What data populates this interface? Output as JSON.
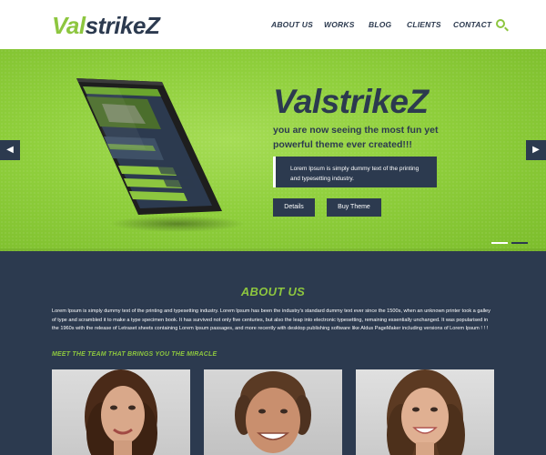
{
  "header": {
    "logo_part1": "Val",
    "logo_part2": "strikeZ",
    "nav": [
      "ABOUT US",
      "WORKS",
      "BLOG",
      "CLIENTS",
      "CONTACT"
    ],
    "search_icon": "search-icon"
  },
  "hero": {
    "title": "ValstrikeZ",
    "subtitle": "you are now seeing the most fun yet powerful theme ever created!!!",
    "quote": "Lorem Ipsum is simply dummy text of the printing and typesetting industry.",
    "details_label": "Details",
    "buy_label": "Buy Theme",
    "prev_icon": "chevron-left-icon",
    "next_icon": "chevron-right-icon",
    "slides": 2,
    "active_slide": 1
  },
  "about": {
    "title": "ABOUT US",
    "text": "Lorem Ipsum is simply dummy text of the printing and typesetting industry. Lorem Ipsum has been the industry's standard dummy text ever since the 1500s, when an unknown printer took a galley of type and scrambled it to make a type specimen book. It has survived not only five centuries, but also the leap into electronic typesetting, remaining essentially unchanged. It was popularised in the 1960s with the release of Letraset sheets containing Lorem Ipsum passages, and more recently with desktop publishing software like Aldus PageMaker including versions of Lorem Ipsum ! ! !",
    "team_heading": "MEET THE TEAM THAT BRINGS YOU THE MIRACLE"
  },
  "colors": {
    "accent": "#8dc63f",
    "navy": "#2c3a4f",
    "white": "#ffffff"
  }
}
